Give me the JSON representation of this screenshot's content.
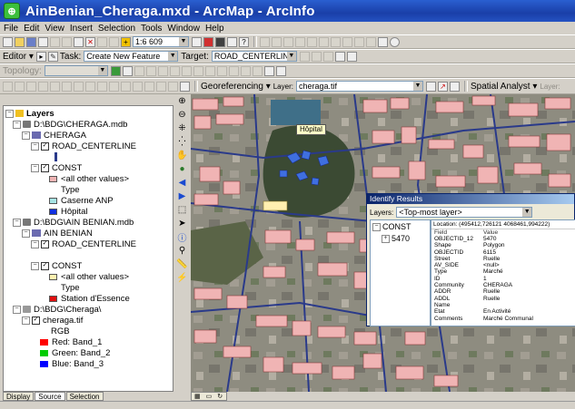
{
  "app": {
    "title": "AinBenian_Cheraga.mxd - ArcMap - ArcInfo"
  },
  "menu": {
    "items": [
      "File",
      "Edit",
      "View",
      "Insert",
      "Selection",
      "Tools",
      "Window",
      "Help"
    ]
  },
  "standard_toolbar": {
    "scale": "1:6 609"
  },
  "editor_toolbar": {
    "editor_label": "Editor ▾",
    "task_label": "Task:",
    "task_value": "Create New Feature",
    "target_label": "Target:",
    "target_value": "ROAD_CENTERLINE"
  },
  "topology_toolbar": {
    "label": "Topology:"
  },
  "georef_toolbar": {
    "georef_label": "Georeferencing ▾",
    "layer_label": "Layer:",
    "layer_value": "cheraga.tif",
    "spatial_label": "Spatial Analyst ▾",
    "spatial_layer_label": "Layer:"
  },
  "toc": {
    "rows": [
      {
        "text": "Layers",
        "bold": true
      },
      {
        "text": "D:\\BDG\\CHERAGA.mdb"
      },
      {
        "text": "CHERAGA"
      },
      {
        "text": "ROAD_CENTERLINE"
      },
      {
        "text": ""
      },
      {
        "text": "CONST"
      },
      {
        "text": "<all other values>"
      },
      {
        "text": "Type"
      },
      {
        "text": "Caserne ANP"
      },
      {
        "text": "Hôpital"
      },
      {
        "text": "D:\\BDG\\AIN BENIAN.mdb"
      },
      {
        "text": "AIN BENIAN"
      },
      {
        "text": "ROAD_CENTERLINE"
      },
      {
        "text": ""
      },
      {
        "text": "CONST"
      },
      {
        "text": "<all other values>"
      },
      {
        "text": "Type"
      },
      {
        "text": "Station d'Essence"
      },
      {
        "text": "D:\\BDG\\Cheraga\\"
      },
      {
        "text": "cheraga.tif"
      },
      {
        "text": "RGB"
      },
      {
        "text": "Red:   Band_1"
      },
      {
        "text": "Green: Band_2"
      },
      {
        "text": "Blue:  Band_3"
      }
    ],
    "tabs": [
      "Display",
      "Source",
      "Selection"
    ]
  },
  "colors": {
    "symbol_pink": "#f0b4b4",
    "symbol_cyan": "#a6e4e4",
    "symbol_blue": "#1030e0",
    "symbol_red": "#e01010",
    "symbol_yellow": "#fff0b0",
    "band_red": "#ff0000",
    "band_green": "#00cc00",
    "band_blue": "#0000ff",
    "road": "#2a3a8a"
  },
  "map": {
    "tooltip": "Hôpital"
  },
  "identify": {
    "title": "Identify Results",
    "layers_label": "Layers:",
    "layers_value": "<Top-most layer>",
    "tree_root": "CONST",
    "tree_child": "5470",
    "location": "Location: (495412,726121  4068461,994222)",
    "col_field": "Field",
    "col_value": "Value",
    "rows": [
      [
        "OBJECTID_12",
        "5470"
      ],
      [
        "Shape",
        "Polygon"
      ],
      [
        "OBJECTID",
        "6115"
      ],
      [
        "Street",
        "Ruelle"
      ],
      [
        "AV_SIDE",
        "<null>"
      ],
      [
        "Type",
        "Marché"
      ],
      [
        "ID",
        "1"
      ],
      [
        "Community",
        "CHERAGA"
      ],
      [
        "ADDR",
        "Ruelle"
      ],
      [
        "ADDL",
        "Ruelle"
      ],
      [
        "Name",
        ""
      ],
      [
        "Etat",
        "En Activité"
      ],
      [
        "Comments",
        "Marché Communal"
      ]
    ]
  }
}
